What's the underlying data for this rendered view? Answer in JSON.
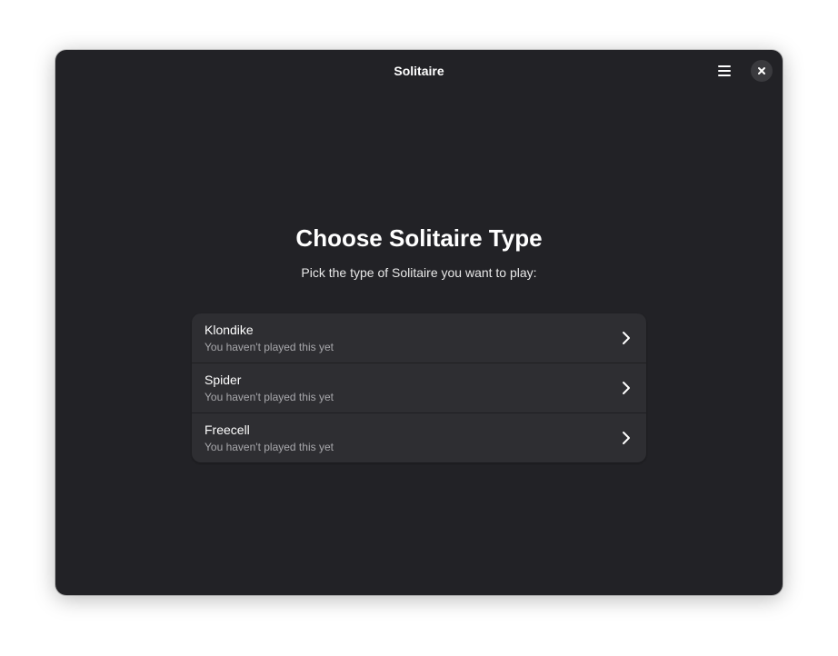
{
  "window": {
    "title": "Solitaire"
  },
  "headerbar": {
    "menu_icon": "hamburger-menu-icon",
    "close_icon": "close-icon"
  },
  "main": {
    "heading": "Choose Solitaire Type",
    "subheading": "Pick the type of Solitaire you want to play:",
    "games": [
      {
        "title": "Klondike",
        "subtitle": "You haven't played this yet",
        "icon": "chevron-right-icon"
      },
      {
        "title": "Spider",
        "subtitle": "You haven't played this yet",
        "icon": "chevron-right-icon"
      },
      {
        "title": "Freecell",
        "subtitle": "You haven't played this yet",
        "icon": "chevron-right-icon"
      }
    ]
  },
  "colors": {
    "window_bg": "#222226",
    "list_bg": "#2e2e32",
    "text": "#ffffff",
    "subtitle_text": "#a8a8ac"
  }
}
